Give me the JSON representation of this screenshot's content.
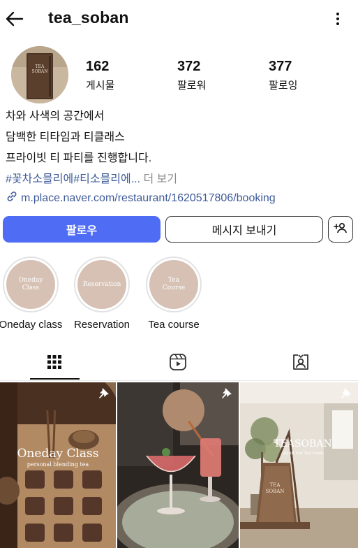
{
  "header": {
    "username": "tea_soban"
  },
  "avatar": {
    "line1": "TEA",
    "line2": "SOBAN"
  },
  "stats": [
    {
      "value": "162",
      "label": "게시물"
    },
    {
      "value": "372",
      "label": "팔로워"
    },
    {
      "value": "377",
      "label": "팔로잉"
    }
  ],
  "bio": {
    "line1": "차와 사색의 공간에서",
    "line2": "담백한 티타임과 티클래스",
    "line3": "프라이빗 티 파티를 진행합니다.",
    "tags": "#꽃차소믈리에#티소믈리에...",
    "more": " 더 보기",
    "link": "m.place.naver.com/restaurant/1620517806/booking"
  },
  "buttons": {
    "follow": "팔로우",
    "message": "메시지 보내기"
  },
  "highlights": [
    {
      "title1": "Oneday",
      "title2": "Class",
      "caption": "Oneday class"
    },
    {
      "title1": "Reservation",
      "title2": "",
      "caption": "Reservation"
    },
    {
      "title1": "Tea",
      "title2": "Course",
      "caption": "Tea course"
    }
  ],
  "posts": [
    {
      "title": "Oneday Class",
      "subtitle": "personal blending tea"
    },
    {
      "title": "",
      "subtitle": ""
    },
    {
      "title": "TEASOBAN",
      "subtitle": "about our tea room",
      "sign1": "TEA",
      "sign2": "SOBAN"
    }
  ],
  "colors": {
    "accent": "#4f6cf5",
    "link": "#3d5a98",
    "highlight": "#d6c1b4"
  }
}
